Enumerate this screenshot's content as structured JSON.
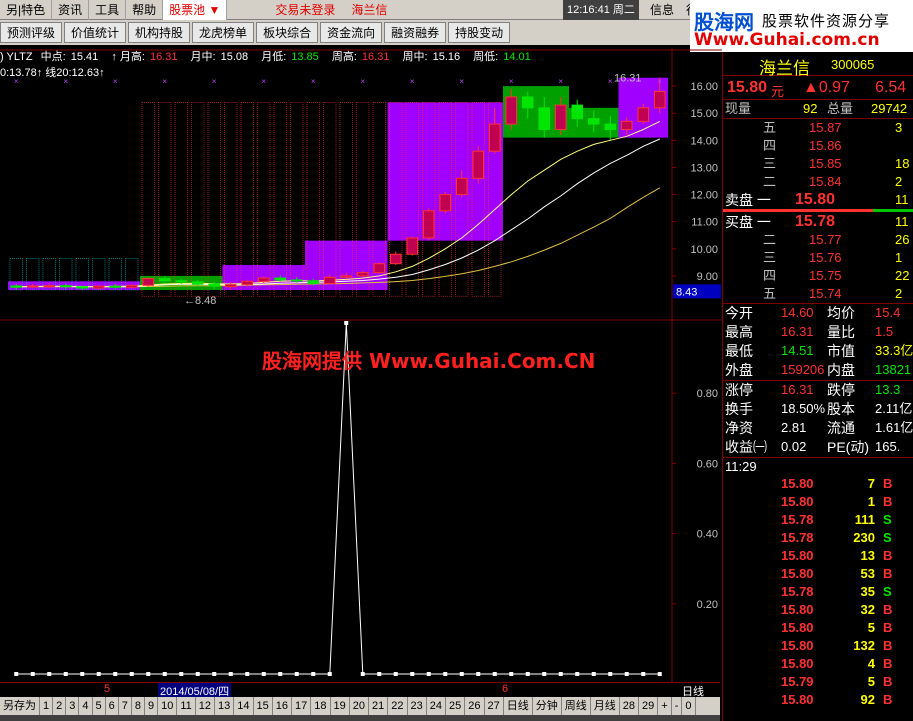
{
  "menu": {
    "items": [
      "另|特色",
      "资讯",
      "工具",
      "帮助"
    ],
    "active": "股票池",
    "arrow": "▼",
    "trade": "交易未登录",
    "stock": "海兰信",
    "clock": "12:16:41 周二",
    "right": [
      "信息",
      "行"
    ]
  },
  "toolbar": [
    "预测评级",
    "价值统计",
    "机构持股",
    "龙虎榜单",
    "板块综合",
    "资金流向",
    "融资融券",
    "持股变动"
  ],
  "logo": {
    "l1": "股海网",
    "l2": "股票软件资源分享",
    "l3": "Www.Guhai.com.cn"
  },
  "indicators": {
    "name": ") YLTZ",
    "items": [
      {
        "label": "中点:",
        "value": "15.41",
        "color": "#ffffff"
      },
      {
        "label": "↑ 月高:",
        "value": "16.31",
        "color": "#ff3232"
      },
      {
        "label": "月中:",
        "value": "15.08",
        "color": "#ffffff"
      },
      {
        "label": "月低:",
        "value": "13.85",
        "color": "#00e600"
      },
      {
        "label": "周高:",
        "value": "16.31",
        "color": "#ff3232"
      },
      {
        "label": "周中:",
        "value": "15.16",
        "color": "#ffffff"
      },
      {
        "label": "周低:",
        "value": "14.01",
        "color": "#00e600"
      }
    ],
    "line2": "0:13.78↑ 线20:12.63↑"
  },
  "chart_data": [
    {
      "type": "candlestick",
      "title": "",
      "ylim": [
        8.0,
        16.3
      ],
      "yticks": [
        "16.00",
        "15.00",
        "14.00",
        "13.00",
        "12.00",
        "11.00",
        "10.00",
        "9.00"
      ],
      "last_label": "8.43",
      "high_label": "16.31",
      "low_label": "←8.48",
      "candles": [
        {
          "o": 8.63,
          "c": 8.58,
          "h": 8.7,
          "l": 8.5
        },
        {
          "o": 8.6,
          "c": 8.63,
          "h": 8.71,
          "l": 8.54
        },
        {
          "o": 8.62,
          "c": 8.64,
          "h": 8.72,
          "l": 8.55
        },
        {
          "o": 8.64,
          "c": 8.6,
          "h": 8.72,
          "l": 8.52
        },
        {
          "o": 8.6,
          "c": 8.55,
          "h": 8.65,
          "l": 8.49
        },
        {
          "o": 8.55,
          "c": 8.62,
          "h": 8.67,
          "l": 8.5
        },
        {
          "o": 8.62,
          "c": 8.58,
          "h": 8.7,
          "l": 8.52
        },
        {
          "o": 8.58,
          "c": 8.65,
          "h": 8.7,
          "l": 8.54
        },
        {
          "o": 8.65,
          "c": 8.9,
          "h": 8.96,
          "l": 8.6
        },
        {
          "o": 8.9,
          "c": 8.82,
          "h": 8.98,
          "l": 8.75
        },
        {
          "o": 8.82,
          "c": 8.78,
          "h": 8.9,
          "l": 8.7
        },
        {
          "o": 8.78,
          "c": 8.7,
          "h": 8.85,
          "l": 8.62
        },
        {
          "o": 8.7,
          "c": 8.62,
          "h": 8.78,
          "l": 8.5
        },
        {
          "o": 8.6,
          "c": 8.68,
          "h": 8.78,
          "l": 8.48
        },
        {
          "o": 8.68,
          "c": 8.8,
          "h": 8.86,
          "l": 8.6
        },
        {
          "o": 8.8,
          "c": 8.92,
          "h": 8.99,
          "l": 8.74
        },
        {
          "o": 8.92,
          "c": 8.85,
          "h": 9.02,
          "l": 8.8
        },
        {
          "o": 8.85,
          "c": 8.82,
          "h": 8.96,
          "l": 8.75
        },
        {
          "o": 8.82,
          "c": 8.72,
          "h": 8.9,
          "l": 8.64
        },
        {
          "o": 8.72,
          "c": 8.95,
          "h": 9.05,
          "l": 8.68
        },
        {
          "o": 8.95,
          "c": 9.0,
          "h": 9.12,
          "l": 8.88
        },
        {
          "o": 9.0,
          "c": 9.12,
          "h": 9.2,
          "l": 8.95
        },
        {
          "o": 9.12,
          "c": 9.45,
          "h": 9.5,
          "l": 9.08
        },
        {
          "o": 9.45,
          "c": 9.8,
          "h": 9.9,
          "l": 9.4
        },
        {
          "o": 9.8,
          "c": 10.4,
          "h": 10.45,
          "l": 9.75
        },
        {
          "o": 10.4,
          "c": 11.4,
          "h": 11.5,
          "l": 10.3
        },
        {
          "o": 11.4,
          "c": 12.0,
          "h": 12.1,
          "l": 11.3
        },
        {
          "o": 12.0,
          "c": 12.6,
          "h": 12.9,
          "l": 11.9
        },
        {
          "o": 12.6,
          "c": 13.6,
          "h": 13.8,
          "l": 12.4
        },
        {
          "o": 13.6,
          "c": 14.6,
          "h": 15.2,
          "l": 13.5
        },
        {
          "o": 14.6,
          "c": 15.6,
          "h": 15.9,
          "l": 14.4
        },
        {
          "o": 15.6,
          "c": 15.2,
          "h": 15.8,
          "l": 14.8
        },
        {
          "o": 15.2,
          "c": 14.4,
          "h": 15.6,
          "l": 14.1
        },
        {
          "o": 14.4,
          "c": 15.3,
          "h": 15.6,
          "l": 14.2
        },
        {
          "o": 15.3,
          "c": 14.8,
          "h": 15.5,
          "l": 14.5
        },
        {
          "o": 14.8,
          "c": 14.6,
          "h": 15.1,
          "l": 14.3
        },
        {
          "o": 14.6,
          "c": 14.4,
          "h": 14.9,
          "l": 14.01
        },
        {
          "o": 14.4,
          "c": 14.7,
          "h": 14.85,
          "l": 14.2
        },
        {
          "o": 14.7,
          "c": 15.2,
          "h": 15.35,
          "l": 14.6
        },
        {
          "o": 15.2,
          "c": 15.8,
          "h": 16.31,
          "l": 15.0
        }
      ],
      "ma1": [
        8.6,
        8.61,
        8.61,
        8.61,
        8.6,
        8.6,
        8.6,
        8.6,
        8.64,
        8.67,
        8.69,
        8.69,
        8.68,
        8.67,
        8.68,
        8.7,
        8.73,
        8.75,
        8.76,
        8.78,
        8.8,
        8.83,
        8.88,
        8.95,
        9.05,
        9.22,
        9.42,
        9.66,
        9.95,
        10.3,
        10.7,
        11.1,
        11.55,
        11.95,
        12.4,
        12.8,
        13.15,
        13.45,
        13.78,
        14.05
      ],
      "ma2": [
        8.6,
        8.6,
        8.6,
        8.6,
        8.6,
        8.6,
        8.6,
        8.6,
        8.61,
        8.62,
        8.63,
        8.64,
        8.64,
        8.65,
        8.66,
        8.67,
        8.68,
        8.69,
        8.7,
        8.71,
        8.72,
        8.74,
        8.76,
        8.79,
        8.83,
        8.9,
        8.98,
        9.08,
        9.2,
        9.35,
        9.52,
        9.72,
        9.95,
        10.2,
        10.5,
        10.8,
        11.12,
        11.52,
        11.9,
        12.25
      ],
      "ma3": [
        8.6,
        8.61,
        8.62,
        8.62,
        8.61,
        8.61,
        8.62,
        8.62,
        8.66,
        8.7,
        8.72,
        8.73,
        8.71,
        8.7,
        8.72,
        8.76,
        8.8,
        8.82,
        8.81,
        8.84,
        8.87,
        8.92,
        9.0,
        9.15,
        9.35,
        9.65,
        10.0,
        10.4,
        10.9,
        11.45,
        12.0,
        12.5,
        12.9,
        13.3,
        13.6,
        13.85,
        14.0,
        14.15,
        14.4,
        14.7
      ]
    },
    {
      "type": "line",
      "title": "",
      "ylim": [
        0.0,
        1.0
      ],
      "yticks": [
        "0.80",
        "0.60",
        "0.40",
        "0.20"
      ],
      "values": [
        0,
        0,
        0,
        0,
        0,
        0,
        0,
        0,
        0,
        0,
        0,
        0,
        0,
        0,
        0,
        0,
        0,
        0,
        0,
        0,
        1,
        0,
        0,
        0,
        0,
        0,
        0,
        0,
        0,
        0,
        0,
        0,
        0,
        0,
        0,
        0,
        0,
        0,
        0,
        0
      ]
    }
  ],
  "watermark": "股海网提供 Www.Guhai.Com.CN",
  "dates": {
    "d1": "5",
    "d2": "2014/05/08/四",
    "d3": "6"
  },
  "tabs": [
    "另存为",
    "1",
    "2",
    "3",
    "4",
    "5",
    "6",
    "7",
    "8",
    "9",
    "10",
    "11",
    "12",
    "13",
    "14",
    "15",
    "16",
    "17",
    "18",
    "19",
    "20",
    "21",
    "22",
    "23",
    "24",
    "25",
    "26",
    "27",
    "日线",
    "分钟",
    "周线",
    "月线",
    "28",
    "29",
    "+",
    "-",
    "0"
  ],
  "period_label": "日线",
  "quote": {
    "name": "海兰信",
    "code": "300065",
    "price": "15.80",
    "unit": "元",
    "change": "▲0.97",
    "pct": "6.54",
    "xianliang_label": "现量",
    "xianliang": "92",
    "zongliang_label": "总量",
    "zongliang": "29742",
    "sell": [
      {
        "lvl": "五",
        "p": "15.87",
        "v": "3"
      },
      {
        "lvl": "四",
        "p": "15.86",
        "v": ""
      },
      {
        "lvl": "三",
        "p": "15.85",
        "v": "18"
      },
      {
        "lvl": "二",
        "p": "15.84",
        "v": "2"
      },
      {
        "lvl": "卖盘 一",
        "p": "15.80",
        "v": "11"
      }
    ],
    "buy": [
      {
        "lvl": "买盘 一",
        "p": "15.78",
        "v": "11"
      },
      {
        "lvl": "二",
        "p": "15.77",
        "v": "26"
      },
      {
        "lvl": "三",
        "p": "15.76",
        "v": "1"
      },
      {
        "lvl": "四",
        "p": "15.75",
        "v": "22"
      },
      {
        "lvl": "五",
        "p": "15.74",
        "v": "2"
      }
    ],
    "stats": [
      {
        "l1": "今开",
        "v1": "14.60",
        "c1": "red",
        "l2": "均价",
        "v2": "15.4",
        "c2": "red"
      },
      {
        "l1": "最高",
        "v1": "16.31",
        "c1": "red",
        "l2": "量比",
        "v2": "1.5",
        "c2": "red"
      },
      {
        "l1": "最低",
        "v1": "14.51",
        "c1": "grn",
        "l2": "市值",
        "v2": "33.3亿",
        "c2": "yel"
      },
      {
        "l1": "外盘",
        "v1": "159206",
        "c1": "red",
        "l2": "内盘",
        "v2": "13821",
        "c2": "grn"
      }
    ],
    "stats2": [
      {
        "l1": "涨停",
        "v1": "16.31",
        "c1": "red",
        "l2": "跌停",
        "v2": "13.3",
        "c2": "grn"
      },
      {
        "l1": "换手",
        "v1": "18.50%",
        "c1": "wht",
        "l2": "股本",
        "v2": "2.11亿",
        "c2": "wht"
      },
      {
        "l1": "净资",
        "v1": "2.81",
        "c1": "wht",
        "l2": "流通",
        "v2": "1.61亿",
        "c2": "wht"
      },
      {
        "l1": "收益㈠",
        "v1": "0.02",
        "c1": "wht",
        "l2": "PE(动)",
        "v2": "165.",
        "c2": "wht"
      }
    ],
    "tick_time": "11:29",
    "ticks": [
      {
        "p": "15.80",
        "v": "7",
        "s": "B"
      },
      {
        "p": "15.80",
        "v": "1",
        "s": "B"
      },
      {
        "p": "15.78",
        "v": "111",
        "s": "S"
      },
      {
        "p": "15.78",
        "v": "230",
        "s": "S"
      },
      {
        "p": "15.80",
        "v": "13",
        "s": "B"
      },
      {
        "p": "15.80",
        "v": "53",
        "s": "B"
      },
      {
        "p": "15.78",
        "v": "35",
        "s": "S"
      },
      {
        "p": "15.80",
        "v": "32",
        "s": "B"
      },
      {
        "p": "15.80",
        "v": "5",
        "s": "B"
      },
      {
        "p": "15.80",
        "v": "132",
        "s": "B"
      },
      {
        "p": "15.80",
        "v": "4",
        "s": "B"
      },
      {
        "p": "15.79",
        "v": "5",
        "s": "B"
      },
      {
        "p": "15.80",
        "v": "92",
        "s": "B"
      }
    ]
  },
  "colors": {
    "up": "#ff3232",
    "down": "#00e600",
    "zone_purple": "#a000ff",
    "zone_green": "#00a000",
    "grid": "#800000"
  }
}
